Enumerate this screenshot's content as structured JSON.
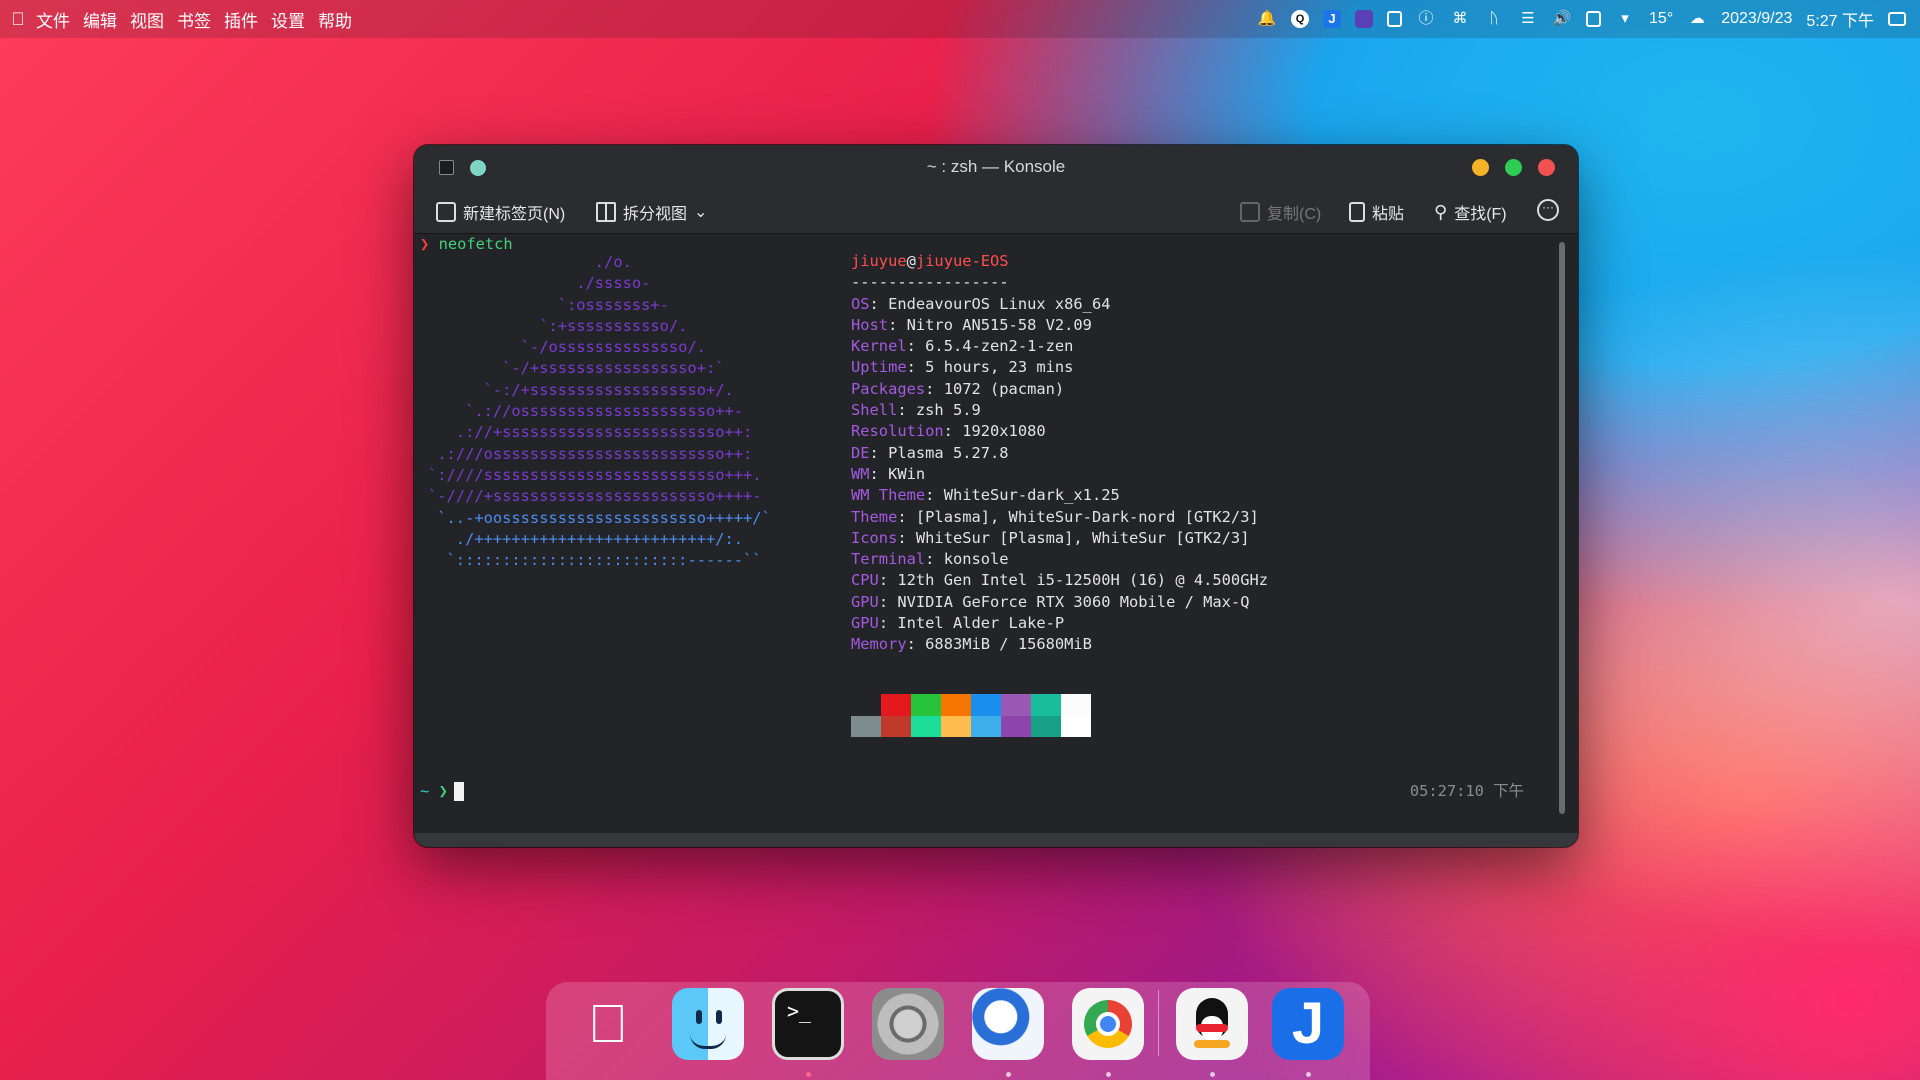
{
  "menubar": {
    "apple_icon": "apple-icon",
    "items": [
      "文件",
      "编辑",
      "视图",
      "书签",
      "插件",
      "设置",
      "帮助"
    ],
    "tray": {
      "weather": "15°",
      "date": "2023/9/23",
      "time": "5:27 下午"
    }
  },
  "window": {
    "title": "~ : zsh — Konsole",
    "toolbar": {
      "new_tab": "新建标签页(N)",
      "split_view": "拆分视图",
      "copy": "复制(C)",
      "paste": "粘贴",
      "find": "查找(F)"
    }
  },
  "terminal": {
    "prompt_symbol": "❯",
    "command": "neofetch",
    "ascii": [
      "                  ./o.",
      "                ./sssso-",
      "              `:osssssss+-",
      "            `:+sssssssssso/.",
      "          `-/ossssssssssssso/.",
      "        `-/+sssssssssssssssso+:`",
      "      `-:/+sssssssssssssssssso+/.",
      "    `.://osssssssssssssssssssso++-",
      "   .://+ssssssssssssssssssssssso++:",
      " .:///osssssssssssssssssssssssso++:",
      "`:////ssssssssssssssssssssssssso+++.",
      "`-////+ssssssssssssssssssssssso++++-",
      " `..-+oossssssssssssssssssssso+++++/`",
      "   ./++++++++++++++++++++++++++/:.",
      "  `:::::::::::::::::::::::::------``"
    ],
    "neofetch": {
      "user": "jiuyue",
      "host": "jiuyue-EOS",
      "separator": "-----------------",
      "fields": [
        {
          "key": "OS",
          "value": "EndeavourOS Linux x86_64"
        },
        {
          "key": "Host",
          "value": "Nitro AN515-58 V2.09"
        },
        {
          "key": "Kernel",
          "value": "6.5.4-zen2-1-zen"
        },
        {
          "key": "Uptime",
          "value": "5 hours, 23 mins"
        },
        {
          "key": "Packages",
          "value": "1072 (pacman)"
        },
        {
          "key": "Shell",
          "value": "zsh 5.9"
        },
        {
          "key": "Resolution",
          "value": "1920x1080"
        },
        {
          "key": "DE",
          "value": "Plasma 5.27.8"
        },
        {
          "key": "WM",
          "value": "KWin"
        },
        {
          "key": "WM Theme",
          "value": "WhiteSur-dark_x1.25"
        },
        {
          "key": "Theme",
          "value": "[Plasma], WhiteSur-Dark-nord [GTK2/3]"
        },
        {
          "key": "Icons",
          "value": "WhiteSur [Plasma], WhiteSur [GTK2/3]"
        },
        {
          "key": "Terminal",
          "value": "konsole"
        },
        {
          "key": "CPU",
          "value": "12th Gen Intel i5-12500H (16) @ 4.500GHz"
        },
        {
          "key": "GPU",
          "value": "NVIDIA GeForce RTX 3060 Mobile / Max-Q"
        },
        {
          "key": "GPU",
          "value": "Intel Alder Lake-P"
        },
        {
          "key": "Memory",
          "value": "6883MiB / 15680MiB"
        }
      ],
      "palette_top": [
        "#232427",
        "#e3191e",
        "#27c43b",
        "#f67400",
        "#1b8ff0",
        "#9b59b6",
        "#1abc9c",
        "#fcfcfc"
      ],
      "palette_bottom": [
        "#7f8c8d",
        "#c0392b",
        "#1cdc9a",
        "#fdbc4b",
        "#3daee9",
        "#8e44ad",
        "#16a085",
        "#ffffff"
      ]
    },
    "prompt2_dir": "~",
    "prompt2_symbol": "❯",
    "right_time": "05:27:10 下午"
  },
  "dock": {
    "items": [
      "apple-icon",
      "finder-icon",
      "terminal-icon",
      "settings-icon",
      "thunderbird-icon",
      "chrome-icon",
      "qq-icon",
      "j-app-icon"
    ],
    "terminal_glyph": ">_",
    "j_glyph": "J"
  }
}
